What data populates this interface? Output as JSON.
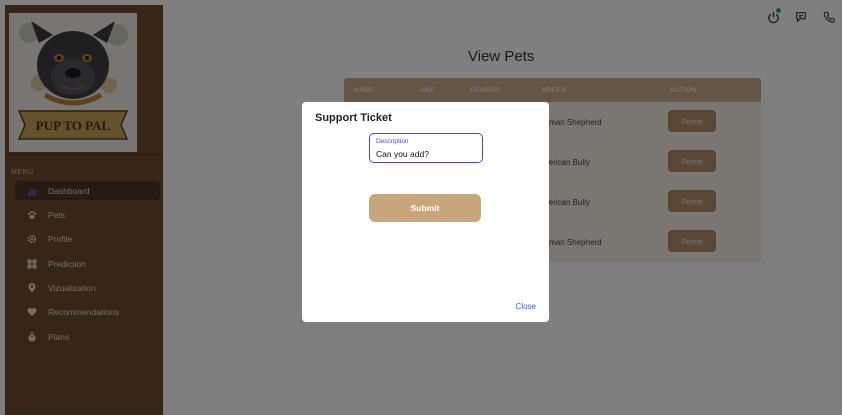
{
  "sidebar": {
    "logo_text": "PUP TO PAL",
    "menu_title": "MENU",
    "items": [
      {
        "label": "Dashboard",
        "icon": "bar-chart-icon",
        "active": true
      },
      {
        "label": "Pets",
        "icon": "paw-icon",
        "active": false
      },
      {
        "label": "Profile",
        "icon": "gear-icon",
        "active": false
      },
      {
        "label": "Prediction",
        "icon": "grid-icon",
        "active": false
      },
      {
        "label": "Vizualization",
        "icon": "location-pin-icon",
        "active": false
      },
      {
        "label": "Recommendations",
        "icon": "heart-icon",
        "active": false
      },
      {
        "label": "Plans",
        "icon": "stopwatch-icon",
        "active": false
      }
    ]
  },
  "header": {
    "icons": [
      "power-icon",
      "chat-icon",
      "phone-icon"
    ],
    "status_color": "#2ab34a"
  },
  "main": {
    "title": "View Pets",
    "table": {
      "columns": [
        "NAME",
        "AGE",
        "GENDER",
        "BREED",
        "ACTION"
      ],
      "rows": [
        {
          "breed": "erman Shepherd",
          "action": "Delete"
        },
        {
          "breed": "merican Bully",
          "action": "Delete"
        },
        {
          "breed": "merican Bully",
          "action": "Delete"
        },
        {
          "breed": "erman Shepherd",
          "action": "Delete"
        }
      ]
    }
  },
  "modal": {
    "title": "Support Ticket",
    "description_label": "Description",
    "description_value": "Can you add?",
    "submit_label": "Submit",
    "close_label": "Close"
  },
  "colors": {
    "sidebar_bg": "#6e4b31",
    "accent": "#c9a57c",
    "field_border": "#4c46d4",
    "link": "#3b5ccc"
  }
}
